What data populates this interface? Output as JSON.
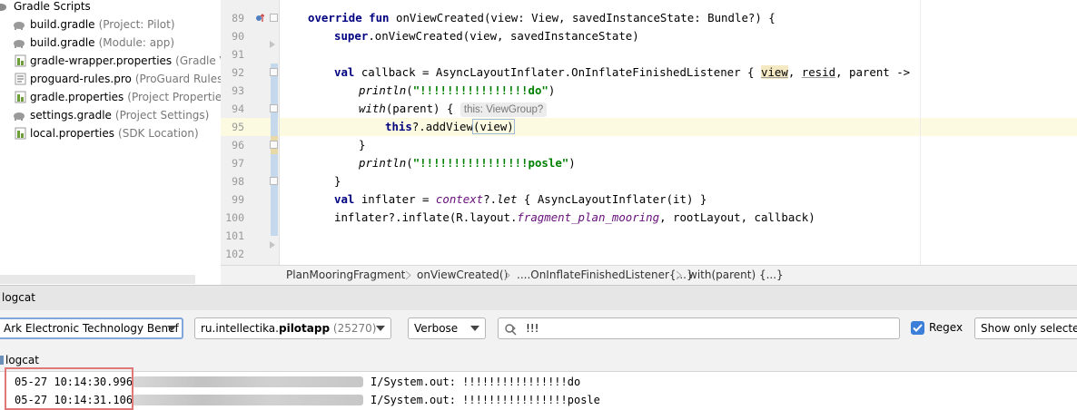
{
  "tree": {
    "items": [
      {
        "label": "Gradle Scripts",
        "hint": "",
        "icon": "gradle-scripts-icon"
      },
      {
        "label": "build.gradle",
        "hint": "(Project: Pilot)",
        "icon": "gradle-elephant-icon"
      },
      {
        "label": "build.gradle",
        "hint": "(Module: app)",
        "icon": "gradle-elephant-icon"
      },
      {
        "label": "gradle-wrapper.properties",
        "hint": "(Gradle Versio",
        "icon": "properties-file-icon"
      },
      {
        "label": "proguard-rules.pro",
        "hint": "(ProGuard Rules for",
        "icon": "proguard-file-icon"
      },
      {
        "label": "gradle.properties",
        "hint": "(Project Properties)",
        "icon": "properties-file-icon"
      },
      {
        "label": "settings.gradle",
        "hint": "(Project Settings)",
        "icon": "gradle-elephant-icon"
      },
      {
        "label": "local.properties",
        "hint": "(SDK Location)",
        "icon": "properties-file-icon"
      }
    ]
  },
  "editor": {
    "line_numbers": [
      "89",
      "90",
      "91",
      "92",
      "93",
      "94",
      "95",
      "96",
      "97",
      "98",
      "99",
      "100",
      "101",
      "102"
    ],
    "lines": {
      "l89_kw": "override fun",
      "l89_rest": " onViewCreated(view: View, savedInstanceState: Bundle?) {",
      "l90_kw": "super",
      "l90_rest": ".onViewCreated(view, savedInstanceState)",
      "l92_kw": "val",
      "l92_a": " callback = AsyncLayoutInflater.OnInflateFinishedListener { ",
      "l92_view": "view",
      "l92_b": ", ",
      "l92_resid": "resid",
      "l92_c": ", parent ->",
      "l93_fn": "println",
      "l93_a": "(",
      "l93_str": "\"!!!!!!!!!!!!!!!!do\"",
      "l93_b": ")",
      "l94_fn": "with",
      "l94_a": "(parent) { ",
      "l94_hint": "this: ViewGroup?",
      "l95_kw": "this",
      "l95_a": "?.addView",
      "l95_b": "(view)",
      "l96": "}",
      "l97_fn": "println",
      "l97_a": "(",
      "l97_str": "\"!!!!!!!!!!!!!!!!posle\"",
      "l97_b": ")",
      "l98": "}",
      "l99_kw": "val",
      "l99_a": " inflater = ",
      "l99_ctx": "context",
      "l99_b": "?.",
      "l99_let": "let",
      "l99_c": " { AsyncLayoutInflater(",
      "l99_it": "it",
      "l99_d": ") }",
      "l100_a": "inflater?.inflate(R.layout.",
      "l100_res": "fragment_plan_mooring",
      "l100_b": ", rootLayout, callback)"
    }
  },
  "breadcrumb": [
    "PlanMooringFragment",
    "onViewCreated()",
    "....OnInflateFinishedListener{...}",
    "with(parent) {...}"
  ],
  "logcat": {
    "panel_title": "logcat",
    "device": "Ark Electronic Technology Benef",
    "process_name": "ru.intellectika.",
    "process_bold": "pilotapp",
    "process_pid": "(25270)",
    "level": "Verbose",
    "search_value": "!!!",
    "regex_label": "Regex",
    "filter": "Show only selected a",
    "tab_label": "logcat",
    "entries": [
      {
        "time": "05-27 10:14:30.996",
        "tag": "I/System.out:",
        "message": "!!!!!!!!!!!!!!!!do"
      },
      {
        "time": "05-27 10:14:31.106",
        "tag": "I/System.out:",
        "message": "!!!!!!!!!!!!!!!!posle"
      }
    ]
  },
  "colors": {
    "keyword": "#000080",
    "string": "#008000",
    "accent": "#3c7fd8",
    "highlight_box": "#e07878"
  }
}
